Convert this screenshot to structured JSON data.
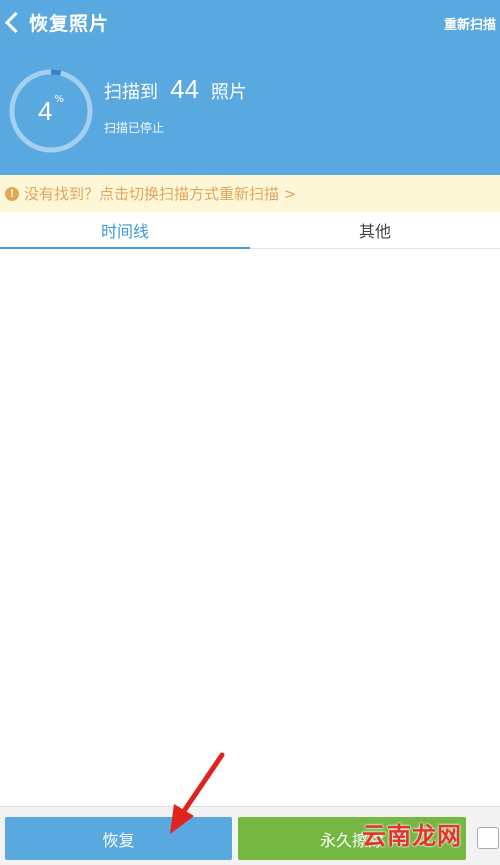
{
  "header": {
    "title": "恢复照片",
    "rescan_label": "重新扫描",
    "progress_percent": 4,
    "progress_value": "4",
    "progress_unit": "%",
    "scan_prefix": "扫描到",
    "scan_count": "44",
    "scan_suffix": "照片",
    "scan_status": "扫描已停止"
  },
  "notice": {
    "icon": "info-icon",
    "text": "没有找到？点击切换扫描方式重新扫描 >"
  },
  "tabs": [
    {
      "label": "时间线",
      "active": true
    },
    {
      "label": "其他",
      "active": false
    }
  ],
  "bottom_bar": {
    "recover_label": "恢复",
    "erase_label": "永久擦除"
  },
  "watermark": "云南龙网",
  "colors": {
    "header_bg": "#5aa8e0",
    "tab_active": "#3d9ad8",
    "notice_bg": "#fdf7d8",
    "notice_text": "#e0a45b",
    "recover_bg": "#5aa8e0",
    "erase_bg": "#74b843",
    "arrow": "#e0231c"
  }
}
